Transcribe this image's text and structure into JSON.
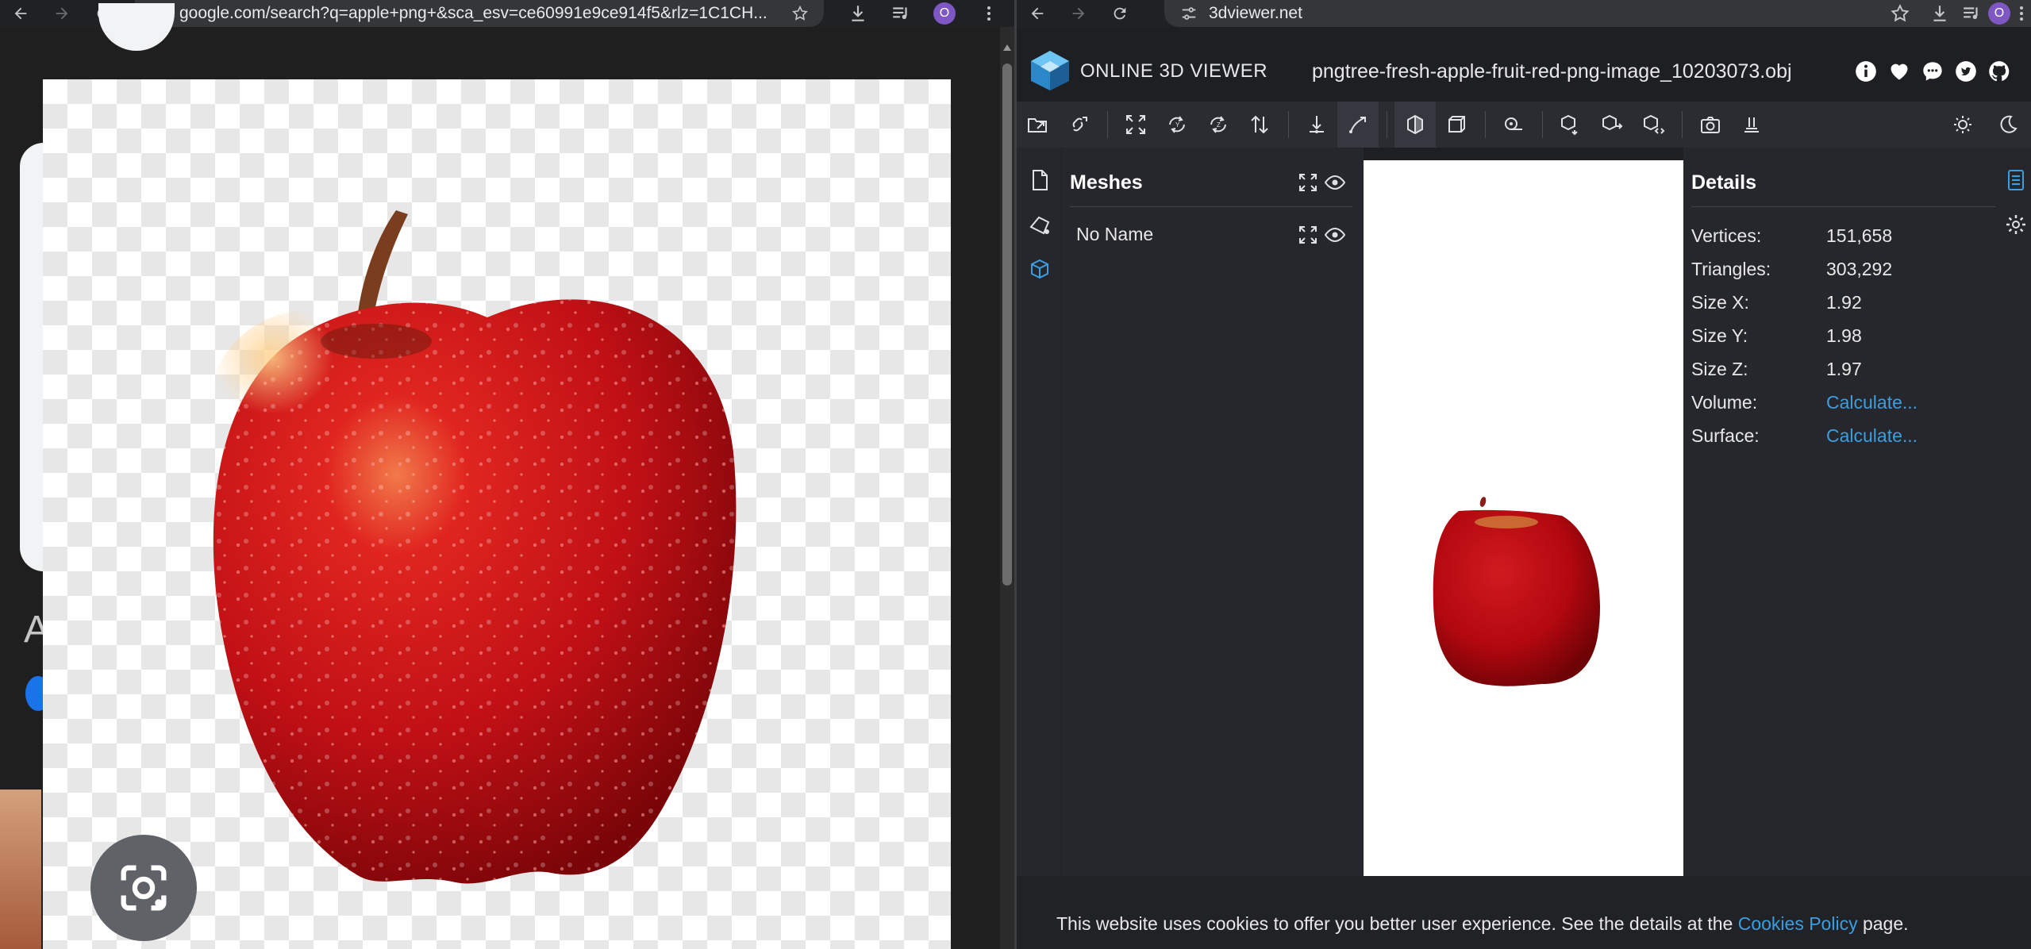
{
  "left_window": {
    "url": "google.com/search?q=apple+png+&sca_esv=ce60991e9ce914f5&rlz=1C1CH...",
    "profile_initial": "O",
    "partial_result_letter": "A",
    "lens_icon": "google-lens-camera-icon",
    "image_subject": "red apple with water droplets on transparent (checkered) background"
  },
  "right_window": {
    "url": "3dviewer.net",
    "profile_initial": "O",
    "header": {
      "brand": "ONLINE 3D VIEWER",
      "file_name": "pngtree-fresh-apple-fruit-red-png-image_10203073.obj",
      "social_icons": [
        "info-icon",
        "heart-icon",
        "chat-icon",
        "twitter-icon",
        "github-icon"
      ]
    },
    "toolbar_icons": [
      "open-file-icon",
      "open-url-icon",
      "fit-to-window-icon",
      "set-up-y-icon",
      "set-up-z-icon",
      "flip-up-icon",
      "fixed-up-vector-icon",
      "free-orbit-icon",
      "perspective-camera-icon",
      "orthographic-camera-icon",
      "measure-icon",
      "export-model-icon",
      "share-model-icon",
      "snapshot-icon",
      "settings-icon",
      "light-mode-icon",
      "dark-mode-icon"
    ],
    "meshes_panel": {
      "title": "Meshes",
      "items": [
        {
          "name": "No Name"
        }
      ]
    },
    "details_panel": {
      "title": "Details",
      "rows": [
        {
          "key": "Vertices:",
          "value": "151,658"
        },
        {
          "key": "Triangles:",
          "value": "303,292"
        },
        {
          "key": "Size X:",
          "value": "1.92"
        },
        {
          "key": "Size Y:",
          "value": "1.98"
        },
        {
          "key": "Size Z:",
          "value": "1.97"
        },
        {
          "key": "Volume:",
          "value": "Calculate..."
        },
        {
          "key": "Surface:",
          "value": "Calculate..."
        }
      ]
    },
    "cookie_banner": {
      "text_before": "This website uses cookies to offer you better user experience. See the details at the",
      "link": "Cookies Policy",
      "text_after": "page."
    }
  },
  "colors": {
    "accent": "#3c9ee0",
    "apple_red": "#c41418",
    "chrome_bg": "#202124",
    "panel_bg": "#25272c"
  }
}
